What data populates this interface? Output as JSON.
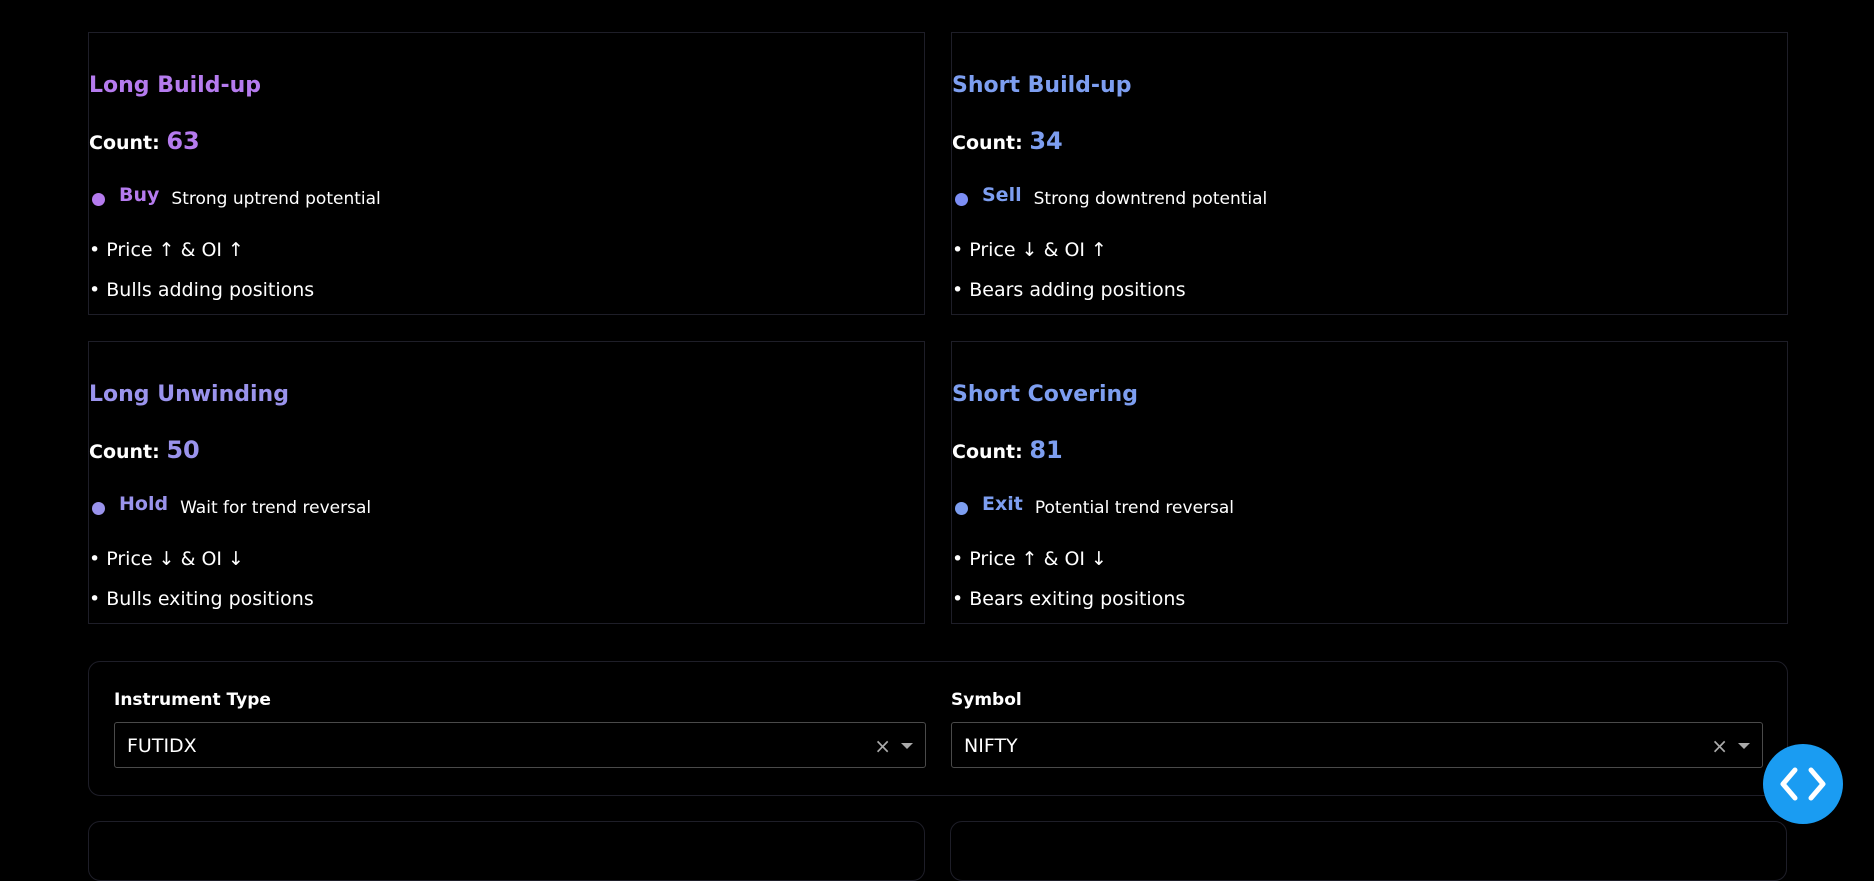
{
  "cards": [
    {
      "title": "Long Build-up",
      "count_label": "Count:",
      "count": "63",
      "signal": "Buy",
      "signal_desc": "Strong uptrend potential",
      "bullet1": "• Price ↑ & OI ↑",
      "bullet2": "• Bulls adding positions",
      "color": "#b57bee"
    },
    {
      "title": "Short Build-up",
      "count_label": "Count:",
      "count": "34",
      "signal": "Sell",
      "signal_desc": "Strong downtrend potential",
      "bullet1": "• Price ↓ & OI ↑",
      "bullet2": "• Bears adding positions",
      "color": "#7d9ef0"
    },
    {
      "title": "Long Unwinding",
      "count_label": "Count:",
      "count": "50",
      "signal": "Hold",
      "signal_desc": "Wait for trend reversal",
      "bullet1": "• Price ↓ & OI ↓",
      "bullet2": "• Bulls exiting positions",
      "color": "#9a93ec"
    },
    {
      "title": "Short Covering",
      "count_label": "Count:",
      "count": "81",
      "signal": "Exit",
      "signal_desc": "Potential trend reversal",
      "bullet1": "• Price ↑ & OI ↓",
      "bullet2": "• Bears exiting positions",
      "color": "#7d9ef0"
    }
  ],
  "filters": {
    "instrument_label": "Instrument Type",
    "instrument_value": "FUTIDX",
    "symbol_label": "Symbol",
    "symbol_value": "NIFTY",
    "clear_glyph": "×"
  },
  "fab": {
    "icon": "code-icon",
    "color": "#1a9cf2"
  }
}
